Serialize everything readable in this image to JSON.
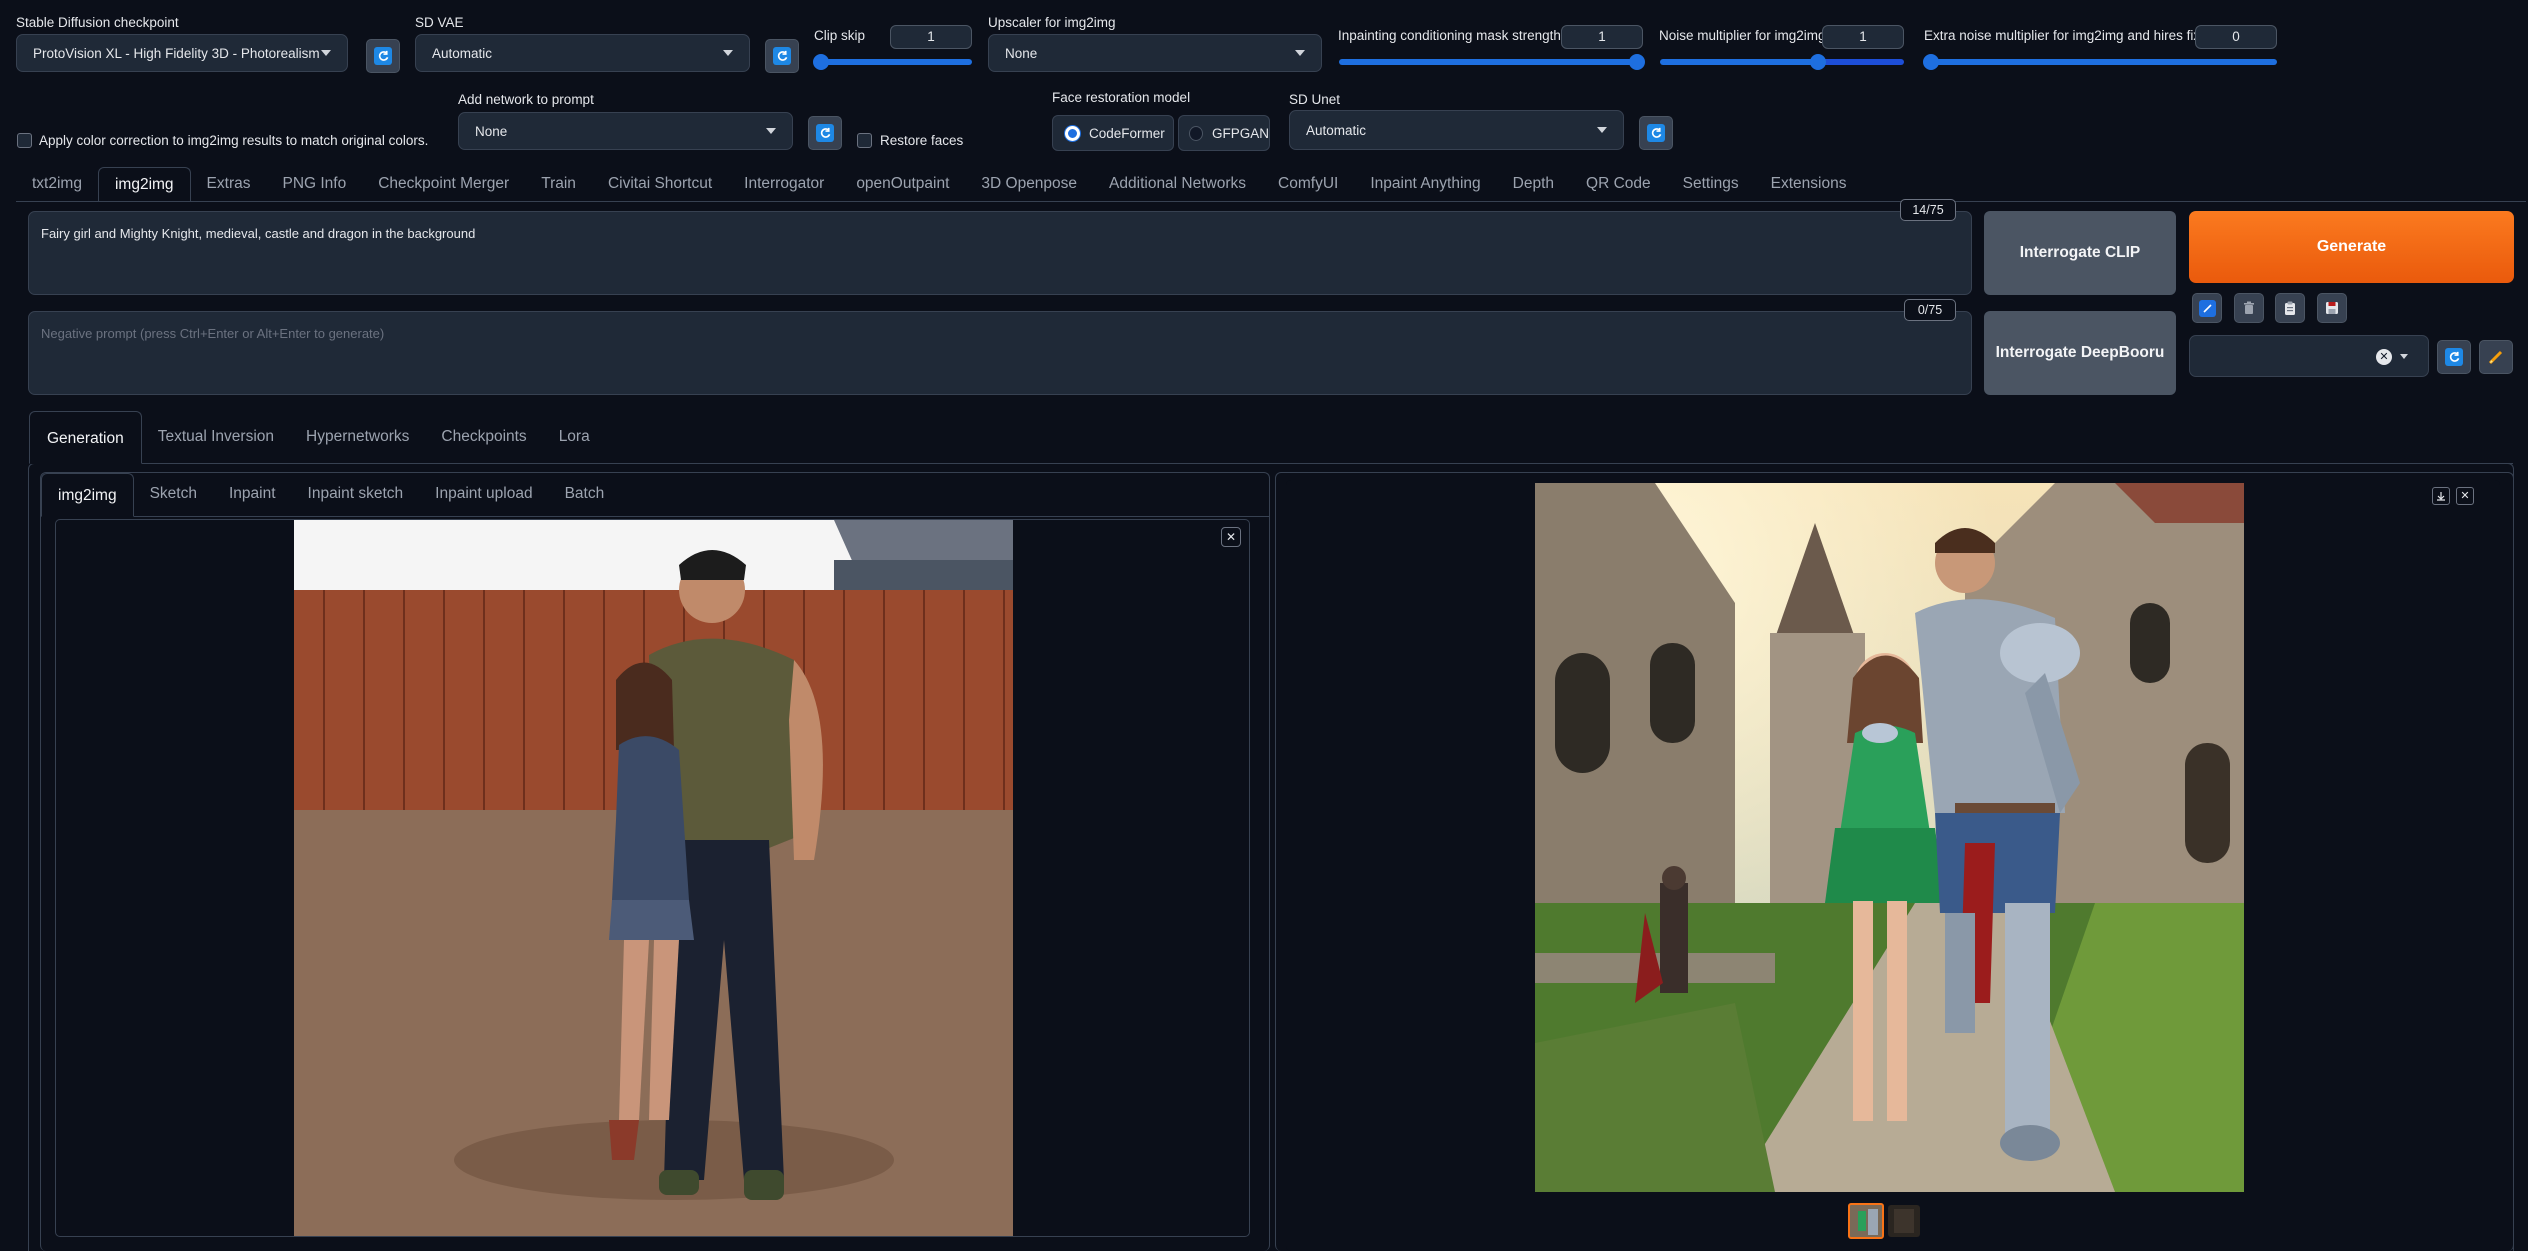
{
  "top": {
    "checkpoint": {
      "label": "Stable Diffusion checkpoint",
      "value": "ProtoVision XL - High Fidelity 3D - Photorealism"
    },
    "vae": {
      "label": "SD VAE",
      "value": "Automatic"
    },
    "clip_skip": {
      "label": "Clip skip",
      "value": "1",
      "fraction": 0.0
    },
    "upscaler": {
      "label": "Upscaler for img2img",
      "value": "None"
    },
    "inpaint_strength": {
      "label": "Inpainting conditioning mask strength",
      "value": "1",
      "fraction": 1.0
    },
    "noise_mult": {
      "label": "Noise multiplier for img2img",
      "value": "1",
      "fraction": 0.65
    },
    "extra_noise": {
      "label": "Extra noise multiplier for img2img and hires fix",
      "value": "0",
      "fraction": 0.0
    },
    "color_correction": {
      "label": "Apply color correction to img2img results to match original colors."
    },
    "add_network": {
      "label": "Add network to prompt",
      "value": "None"
    },
    "restore_faces": {
      "label": "Restore faces"
    },
    "face_restoration": {
      "label": "Face restoration model",
      "options": [
        "CodeFormer",
        "GFPGAN"
      ],
      "selected": "CodeFormer"
    },
    "sd_unet": {
      "label": "SD Unet",
      "value": "Automatic"
    }
  },
  "main_tabs": [
    "txt2img",
    "img2img",
    "Extras",
    "PNG Info",
    "Checkpoint Merger",
    "Train",
    "Civitai Shortcut",
    "Interrogator",
    "openOutpaint",
    "3D Openpose",
    "Additional Networks",
    "ComfyUI",
    "Inpaint Anything",
    "Depth",
    "QR Code",
    "Settings",
    "Extensions"
  ],
  "active_main_tab": "img2img",
  "prompt": {
    "text": "Fairy girl and Mighty Knight, medieval, castle and dragon in the background",
    "counter": "14/75"
  },
  "negative": {
    "placeholder": "Negative prompt (press Ctrl+Enter or Alt+Enter to generate)",
    "counter": "0/75"
  },
  "buttons": {
    "interrogate_clip": "Interrogate CLIP",
    "interrogate_deepbooru": "Interrogate DeepBooru",
    "generate": "Generate"
  },
  "sub_tabs": [
    "Generation",
    "Textual Inversion",
    "Hypernetworks",
    "Checkpoints",
    "Lora"
  ],
  "input_tabs": [
    "img2img",
    "Sketch",
    "Inpaint",
    "Inpaint sketch",
    "Inpaint upload",
    "Batch"
  ],
  "colors": {
    "accent": "#f97316",
    "blue": "#1e6fe0",
    "bg": "#0b0f19",
    "panel": "#1f2937"
  },
  "icons": [
    "refresh-icon",
    "trash-icon",
    "clipboard-icon",
    "save-icon",
    "pencil-icon",
    "close-icon",
    "download-icon"
  ]
}
